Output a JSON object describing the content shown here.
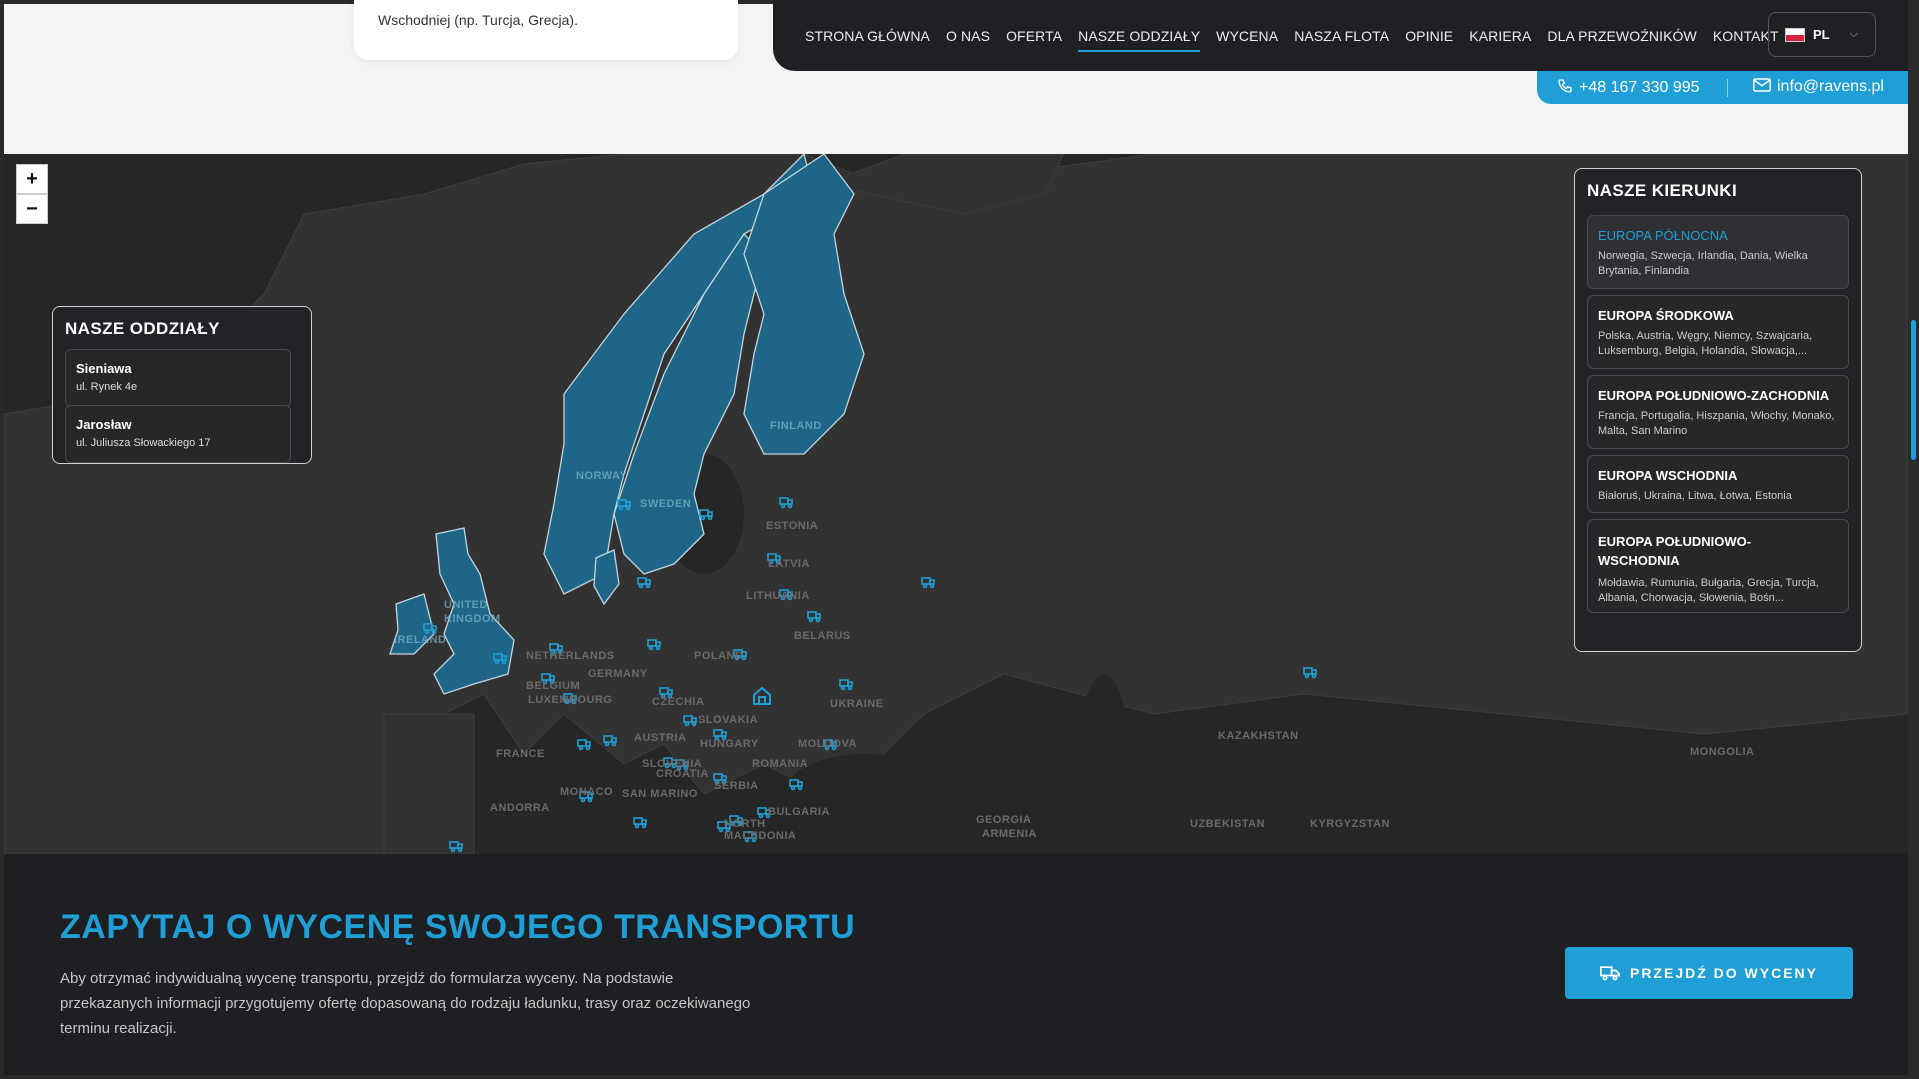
{
  "top_card": {
    "text": "Wschodniej (np. Turcja, Grecja)."
  },
  "nav": {
    "items": [
      "STRONA GŁÓWNA",
      "O NAS",
      "OFERTA",
      "NASZE ODDZIAŁY",
      "WYCENA",
      "NASZA FLOTA",
      "OPINIE",
      "KARIERA",
      "DLA PRZEWOŹNIKÓW",
      "KONTAKT"
    ],
    "active_index": 3,
    "language": "PL"
  },
  "contact": {
    "phone": "+48 167 330 995",
    "email": "info@ravens.pl"
  },
  "map": {
    "zoom_in": "+",
    "zoom_out": "−",
    "branches_title": "NASZE ODDZIAŁY",
    "branches": [
      {
        "name": "Sieniawa",
        "address": "ul. Rynek 4e"
      },
      {
        "name": "Jarosław",
        "address": "ul. Juliusza Słowackiego 17"
      }
    ],
    "directions_title": "NASZE KIERUNKI",
    "directions": [
      {
        "title": "EUROPA PÓŁNOCNA",
        "countries": "Norwegia, Szwecja, Irlandia, Dania, Wielka Brytania, Finlandia"
      },
      {
        "title": "EUROPA ŚRODKOWA",
        "countries": "Polska, Austria, Węgry, Niemcy, Szwajcaria, Luksemburg, Belgia, Holandia, Słowacja,..."
      },
      {
        "title": "EUROPA POŁUDNIOWO-ZACHODNIA",
        "countries": "Francja, Portugalia, Hiszpania, Włochy, Monako, Malta, San Marino"
      },
      {
        "title": "EUROPA WSCHODNIA",
        "countries": "Białoruś, Ukraina, Litwa, Łotwa, Estonia"
      },
      {
        "title": "EUROPA POŁUDNIOWO-WSCHODNIA",
        "countries": "Mołdawia, Rumunia, Bułgaria, Grecja, Turcja, Albania, Chorwacja, Słowenia, Bośn..."
      }
    ],
    "country_labels": [
      "NORWAY",
      "SWEDEN",
      "FINLAND",
      "ESTONIA",
      "LATVIA",
      "LITHUANIA",
      "BELARUS",
      "UNITED KINGDOM",
      "IRELAND",
      "NETHERLANDS",
      "GERMANY",
      "BELGIUM",
      "LUXEMBOURG",
      "POLAND",
      "CZECHIA",
      "SLOVAKIA",
      "AUSTRIA",
      "HUNGARY",
      "UKRAINE",
      "MOLDOVA",
      "ROMANIA",
      "FRANCE",
      "SLOVENIA",
      "CROATIA",
      "SERBIA",
      "MONACO",
      "SAN MARINO",
      "BULGARIA",
      "NORTH MACEDONIA",
      "ANDORRA",
      "GEORGIA",
      "ARMENIA",
      "KAZAKHSTAN",
      "UZBEKISTAN",
      "KYRGYZSTAN",
      "MONGOLIA"
    ],
    "accent": "#1f9fd6",
    "icons": {
      "truck": "truck-icon",
      "home": "home-icon"
    }
  },
  "cta": {
    "title": "ZAPYTAJ O WYCENĘ SWOJEGO TRANSPORTU",
    "text": "Aby otrzymać indywidualną wycenę transportu, przejdź do formularza wyceny. Na podstawie przekazanych informacji przygotujemy ofertę dopasowaną do rodzaju ładunku, trasy oraz oczekiwanego terminu realizacji.",
    "button": "PRZEJDŹ DO WYCENY"
  }
}
